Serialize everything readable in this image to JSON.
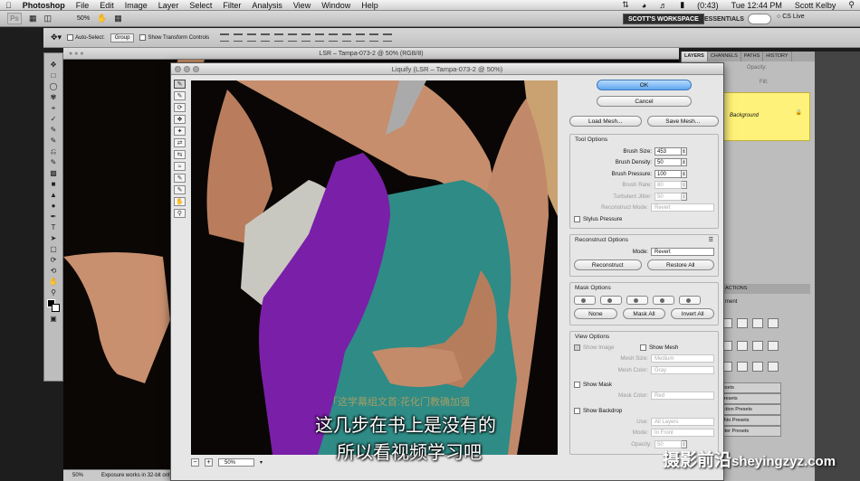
{
  "menubar": {
    "items": [
      "Photoshop",
      "File",
      "Edit",
      "Image",
      "Layer",
      "Select",
      "Filter",
      "Analysis",
      "View",
      "Window",
      "Help"
    ],
    "battery": "(0:43)",
    "clock": "Tue 12:44 PM",
    "user": "Scott Kelby"
  },
  "appbar": {
    "ps_label": "Ps",
    "zoom": "50%",
    "workspace_active": "SCOTT'S WORKSPACE",
    "workspace_other": "ESSENTIALS",
    "cs_live": "CS Live"
  },
  "options": {
    "auto_select_label": "Auto-Select:",
    "auto_select_value": "Group",
    "transform_controls_label": "Show Transform Controls"
  },
  "document": {
    "title": "LSR – Tampa-073-2 @ 50% (RGB/8)",
    "status_zoom": "50%",
    "status_text": "Exposure works in 32-bit only"
  },
  "liquify": {
    "title": "Liquify (LSR – Tampa-073-2 @ 50%)",
    "zoom_value": "50%",
    "ok": "OK",
    "cancel": "Cancel",
    "load_mesh": "Load Mesh...",
    "save_mesh": "Save Mesh...",
    "tool_options": {
      "title": "Tool Options",
      "brush_size_label": "Brush Size:",
      "brush_size": "453",
      "brush_density_label": "Brush Density:",
      "brush_density": "50",
      "brush_pressure_label": "Brush Pressure:",
      "brush_pressure": "100",
      "brush_rate_label": "Brush Rate:",
      "brush_rate": "80",
      "turbulent_jitter_label": "Turbulent Jitter:",
      "turbulent_jitter": "50",
      "reconstruct_mode_label": "Reconstruct Mode:",
      "reconstruct_mode": "Revert",
      "stylus_pressure": "Stylus Pressure"
    },
    "reconstruct_options": {
      "title": "Reconstruct Options",
      "mode_label": "Mode:",
      "mode": "Revert",
      "reconstruct": "Reconstruct",
      "restore_all": "Restore All"
    },
    "mask_options": {
      "title": "Mask Options",
      "none": "None",
      "mask_all": "Mask All",
      "invert_all": "Invert All"
    },
    "view_options": {
      "title": "View Options",
      "show_image": "Show Image",
      "show_mesh": "Show Mesh",
      "mesh_size_label": "Mesh Size:",
      "mesh_size": "Medium",
      "mesh_color_label": "Mesh Color:",
      "mesh_color": "Gray",
      "show_mask": "Show Mask",
      "mask_color_label": "Mask Color:",
      "mask_color": "Red",
      "show_backdrop": "Show Backdrop",
      "use_label": "Use:",
      "use": "All Layers",
      "backdrop_mode_label": "Mode:",
      "backdrop_mode": "In Front",
      "opacity_label": "Opacity:",
      "opacity": "50"
    }
  },
  "panels": {
    "tabs": [
      "LAYERS",
      "CHANNELS",
      "PATHS",
      "HISTORY"
    ],
    "opacity_label": "Opacity:",
    "fill_label": "Fill:",
    "layer_name": "Background",
    "actions_tab": "ACTIONS",
    "mask_label": "ment",
    "presets": [
      "resets",
      "Presets",
      "ection Presets",
      "Phto Presets",
      "Fiter Presets"
    ]
  },
  "subtitle": {
    "line1": "这几步在书上是没有的",
    "line2": "所以看视频学习吧",
    "blurred": "「这学幕组文首:花化门教确加强"
  },
  "watermark": {
    "cn": "摄影前沿",
    "url": "sheyingzyz.com"
  }
}
